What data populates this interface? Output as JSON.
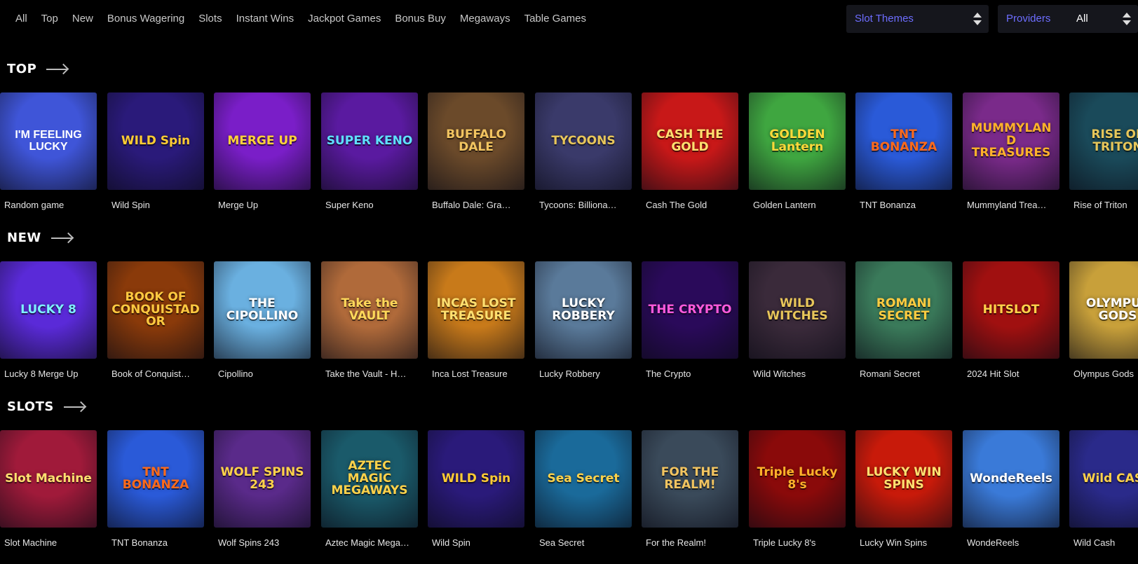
{
  "nav": {
    "tabs": [
      "All",
      "Top",
      "New",
      "Bonus Wagering",
      "Slots",
      "Instant Wins",
      "Jackpot Games",
      "Bonus Buy",
      "Megaways",
      "Table Games"
    ],
    "slot_themes_label": "Slot Themes",
    "providers_label": "Providers",
    "providers_value": "All"
  },
  "sections": [
    {
      "title": "TOP",
      "games": [
        {
          "name": "Random game",
          "art": "I'M FEELING LUCKY",
          "bg": "#3f55d8",
          "fg": "#ffffff"
        },
        {
          "name": "Wild Spin",
          "art": "WILD Spin",
          "bg": "#2a1a7a",
          "fg": "#ffcc33"
        },
        {
          "name": "Merge Up",
          "art": "MERGE UP",
          "bg": "#7a1ec8",
          "fg": "#ffd23a"
        },
        {
          "name": "Super Keno",
          "art": "SUPER KENO",
          "bg": "#5a1aa0",
          "fg": "#5fe0ff"
        },
        {
          "name": "Buffalo Dale: Gra…",
          "art": "BUFFALO DALE",
          "bg": "#6b4a2a",
          "fg": "#f2c460"
        },
        {
          "name": "Tycoons: Billiona…",
          "art": "TYCOONS",
          "bg": "#3a3a6a",
          "fg": "#e8c65a"
        },
        {
          "name": "Cash The Gold",
          "art": "CASH THE GOLD",
          "bg": "#c81818",
          "fg": "#ffe070"
        },
        {
          "name": "Golden Lantern",
          "art": "GOLDEN Lantern",
          "bg": "#3fa640",
          "fg": "#ffd93a"
        },
        {
          "name": "TNT Bonanza",
          "art": "TNT BONANZA",
          "bg": "#2a5ad8",
          "fg": "#ff6a1a"
        },
        {
          "name": "Mummyland Trea…",
          "art": "MUMMYLAND TREASURES",
          "bg": "#7a2a8a",
          "fg": "#ffb22a"
        },
        {
          "name": "Rise of Triton",
          "art": "RISE OF TRITON",
          "bg": "#1a4a5a",
          "fg": "#e6c65a"
        }
      ]
    },
    {
      "title": "NEW",
      "games": [
        {
          "name": "Lucky 8 Merge Up",
          "art": "LUCKY 8",
          "bg": "#5a2ad8",
          "fg": "#7ef0ff"
        },
        {
          "name": "Book of Conquist…",
          "art": "BOOK OF CONQUISTADOR",
          "bg": "#8a3a0a",
          "fg": "#ffc940"
        },
        {
          "name": "Cipollino",
          "art": "THE CIPOLLINO",
          "bg": "#6ab0e0",
          "fg": "#ffffff"
        },
        {
          "name": "Take the Vault - H…",
          "art": "Take the VAULT",
          "bg": "#b06a3a",
          "fg": "#ffd85a"
        },
        {
          "name": "Inca Lost Treasure",
          "art": "INCAS LOST TREASURE",
          "bg": "#c87a1a",
          "fg": "#ffe070"
        },
        {
          "name": "Lucky Robbery",
          "art": "LUCKY ROBBERY",
          "bg": "#5a7a9a",
          "fg": "#ffffff"
        },
        {
          "name": "The Crypto",
          "art": "THE CRYPTO",
          "bg": "#2a0a5a",
          "fg": "#ff5adc"
        },
        {
          "name": "Wild Witches",
          "art": "WILD WITCHES",
          "bg": "#3a2a3a",
          "fg": "#e8c65a"
        },
        {
          "name": "Romani Secret",
          "art": "ROMANI SECRET",
          "bg": "#3a7a5a",
          "fg": "#ffcc40"
        },
        {
          "name": "2024 Hit Slot",
          "art": "HITSLOT",
          "bg": "#a01010",
          "fg": "#ffd24a"
        },
        {
          "name": "Olympus Gods",
          "art": "OLYMPUS GODS",
          "bg": "#c8a03a",
          "fg": "#ffffff"
        }
      ]
    },
    {
      "title": "SLOTS",
      "games": [
        {
          "name": "Slot Machine",
          "art": "Slot Machine",
          "bg": "#a01a3a",
          "fg": "#ffe070"
        },
        {
          "name": "TNT Bonanza",
          "art": "TNT BONANZA",
          "bg": "#2a5ad8",
          "fg": "#ff6a1a"
        },
        {
          "name": "Wolf Spins 243",
          "art": "WOLF SPINS 243",
          "bg": "#5a2a8a",
          "fg": "#ffd24a"
        },
        {
          "name": "Aztec Magic Mega…",
          "art": "AZTEC MAGIC MEGAWAYS",
          "bg": "#1a5a6a",
          "fg": "#ffd24a"
        },
        {
          "name": "Wild Spin",
          "art": "WILD Spin",
          "bg": "#2a1a7a",
          "fg": "#ffcc33"
        },
        {
          "name": "Sea Secret",
          "art": "Sea Secret",
          "bg": "#1a6a9a",
          "fg": "#ffd24a"
        },
        {
          "name": "For the Realm!",
          "art": "FOR THE REALM!",
          "bg": "#3a4a5a",
          "fg": "#f2c460"
        },
        {
          "name": "Triple Lucky 8's",
          "art": "Triple Lucky 8's",
          "bg": "#8a0a0a",
          "fg": "#ffb22a"
        },
        {
          "name": "Lucky Win Spins",
          "art": "LUCKY WIN SPINS",
          "bg": "#c81a0a",
          "fg": "#ffe070"
        },
        {
          "name": "WondeReels",
          "art": "WondeReels",
          "bg": "#3a7ad8",
          "fg": "#ffffff"
        },
        {
          "name": "Wild Cash",
          "art": "Wild CASH",
          "bg": "#2a2a8a",
          "fg": "#ffd24a"
        }
      ]
    }
  ]
}
